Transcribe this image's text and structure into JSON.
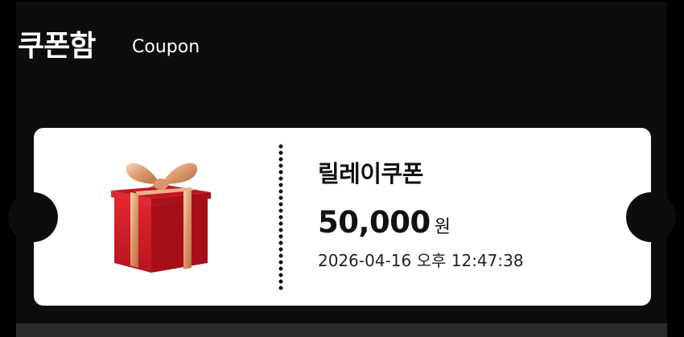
{
  "header": {
    "title": "쿠폰함",
    "subtitle": "Coupon"
  },
  "coupon": {
    "icon": "gift-box-icon",
    "name": "릴레이쿠폰",
    "amount": "50,000",
    "unit": "원",
    "datetime": "2026-04-16 오후 12:47:38"
  },
  "colors": {
    "background": "#0d0d0d",
    "card": "#ffffff",
    "gift_red": "#d4202a",
    "ribbon_gold": "#e8b48e"
  }
}
